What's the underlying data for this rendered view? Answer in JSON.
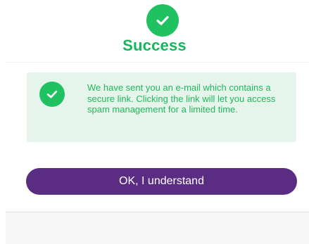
{
  "dialog": {
    "title": "Success",
    "status_icon": "check-circle-icon",
    "alert": {
      "icon": "check-circle-icon",
      "message": "We have sent you an e-mail which contains a secure link. Clicking the link will let you access spam management for a limited time."
    },
    "confirm_button_label": "OK, I understand"
  },
  "colors": {
    "success_green": "#1fc160",
    "success_text": "#17b55c",
    "alert_background": "#e6f5ec",
    "button_purple": "#5a2d82",
    "button_text": "#ffffff"
  }
}
